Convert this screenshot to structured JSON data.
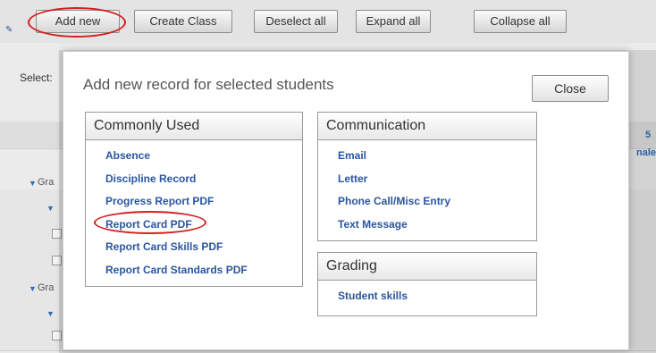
{
  "toolbar": {
    "add_new": "Add new",
    "create_class": "Create Class",
    "deselect_all": "Deselect all",
    "expand_all": "Expand all",
    "collapse_all": "Collapse all"
  },
  "background": {
    "select_label": "Select:",
    "group_label": "Gra",
    "right_number": "5",
    "right_text": "nale"
  },
  "modal": {
    "title": "Add new record for selected students",
    "close_label": "Close",
    "commonly_used": {
      "heading": "Commonly Used",
      "items": [
        "Absence",
        "Discipline Record",
        "Progress Report PDF",
        "Report Card PDF",
        "Report Card Skills PDF",
        "Report Card Standards PDF"
      ]
    },
    "communication": {
      "heading": "Communication",
      "items": [
        "Email",
        "Letter",
        "Phone Call/Misc Entry",
        "Text Message"
      ]
    },
    "grading": {
      "heading": "Grading",
      "items": [
        "Student skills"
      ]
    }
  },
  "annotations": {
    "highlight_color": "#d42020"
  }
}
